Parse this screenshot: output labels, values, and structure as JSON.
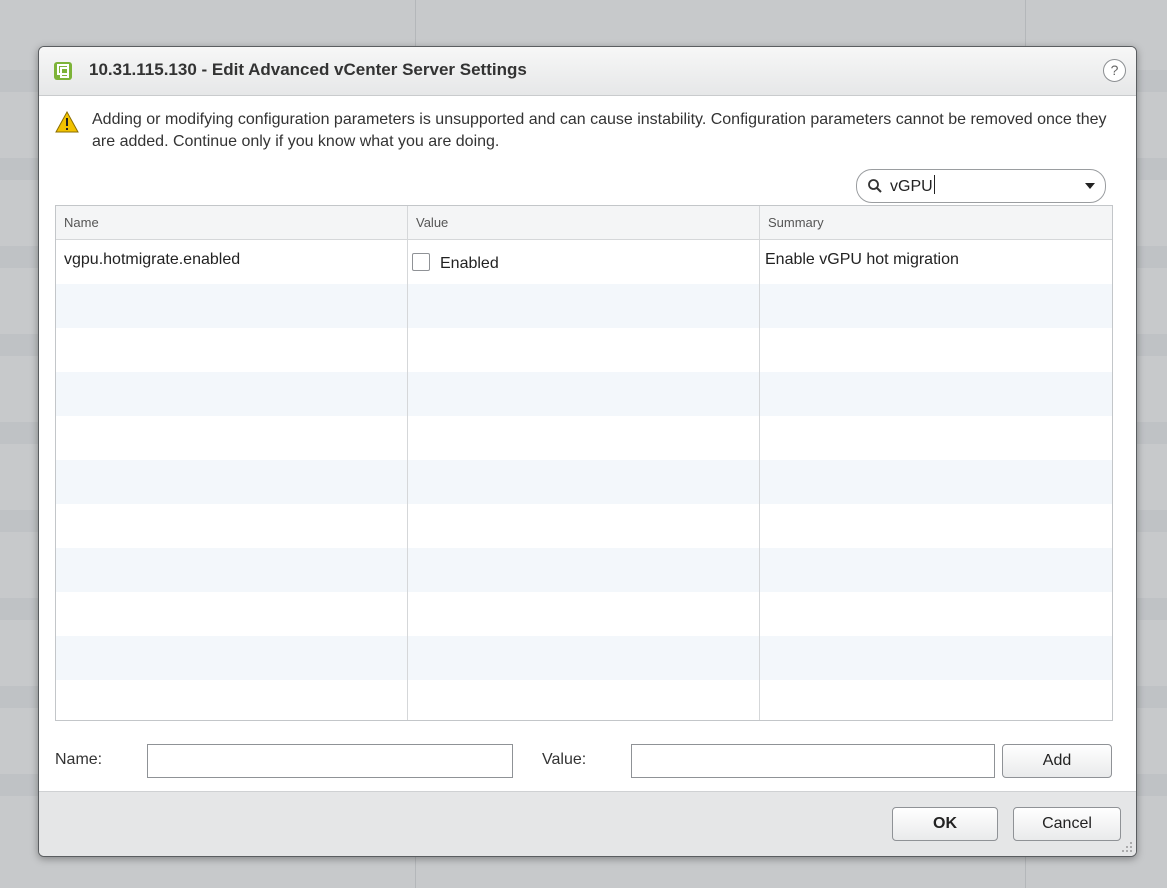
{
  "dialog": {
    "title": "10.31.115.130 - Edit Advanced vCenter Server Settings",
    "help_label": "?",
    "warning": "Adding or modifying configuration parameters is unsupported and can cause instability. Configuration parameters cannot be removed once they are added. Continue only if you know what you are doing."
  },
  "search": {
    "value": "vGPU"
  },
  "table": {
    "columns": [
      "Name",
      "Value",
      "Summary"
    ],
    "rows": [
      {
        "name": "vgpu.hotmigrate.enabled",
        "value_label": "Enabled",
        "checked": false,
        "summary": "Enable vGPU hot migration"
      }
    ]
  },
  "form": {
    "name_label": "Name:",
    "value_label": "Value:",
    "add_button": "Add",
    "name_value": "",
    "value_value": ""
  },
  "footer": {
    "ok_button": "OK",
    "cancel_button": "Cancel"
  },
  "colors": {
    "accent": "#f2c200",
    "row_alt": "#f3f7fb",
    "icon_green": "#7db338"
  }
}
